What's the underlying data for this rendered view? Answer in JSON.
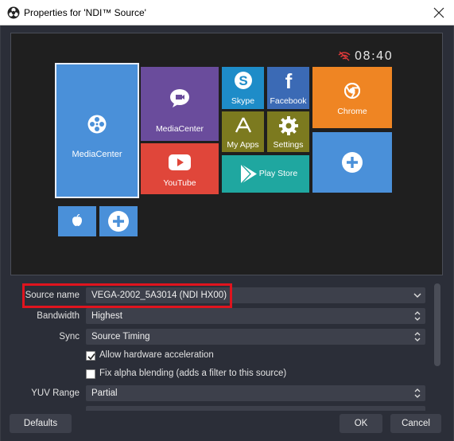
{
  "window": {
    "title": "Properties for 'NDI™ Source'"
  },
  "preview": {
    "clock": "08:40",
    "tiles": {
      "mediacenter_large": "MediaCenter",
      "mediacenter_small": "MediaCenter",
      "youtube": "YouTube",
      "skype": "Skype",
      "facebook": "Facebook",
      "chrome": "Chrome",
      "my_apps": "My Apps",
      "settings": "Settings",
      "play_store": "Play Store"
    },
    "colors": {
      "blue": "#4a90d9",
      "purple": "#6a4c9c",
      "red": "#e0463a",
      "skype": "#1e8cc8",
      "facebook": "#3b6ab5",
      "orange": "#ef8523",
      "olive": "#7c7a1f",
      "teal": "#1fa7a0",
      "highlight": "#e0141e"
    }
  },
  "properties": {
    "source_name": {
      "label": "Source name",
      "value": "VEGA-2002_5A3014 (NDI HX00)"
    },
    "bandwidth": {
      "label": "Bandwidth",
      "value": "Highest"
    },
    "sync": {
      "label": "Sync",
      "value": "Source Timing"
    },
    "hw_accel": {
      "label": "Allow hardware acceleration",
      "checked": true
    },
    "fix_alpha": {
      "label": "Fix alpha blending (adds a filter to this source)",
      "checked": false
    },
    "yuv_range": {
      "label": "YUV Range",
      "value": "Partial"
    }
  },
  "buttons": {
    "defaults": "Defaults",
    "ok": "OK",
    "cancel": "Cancel"
  }
}
